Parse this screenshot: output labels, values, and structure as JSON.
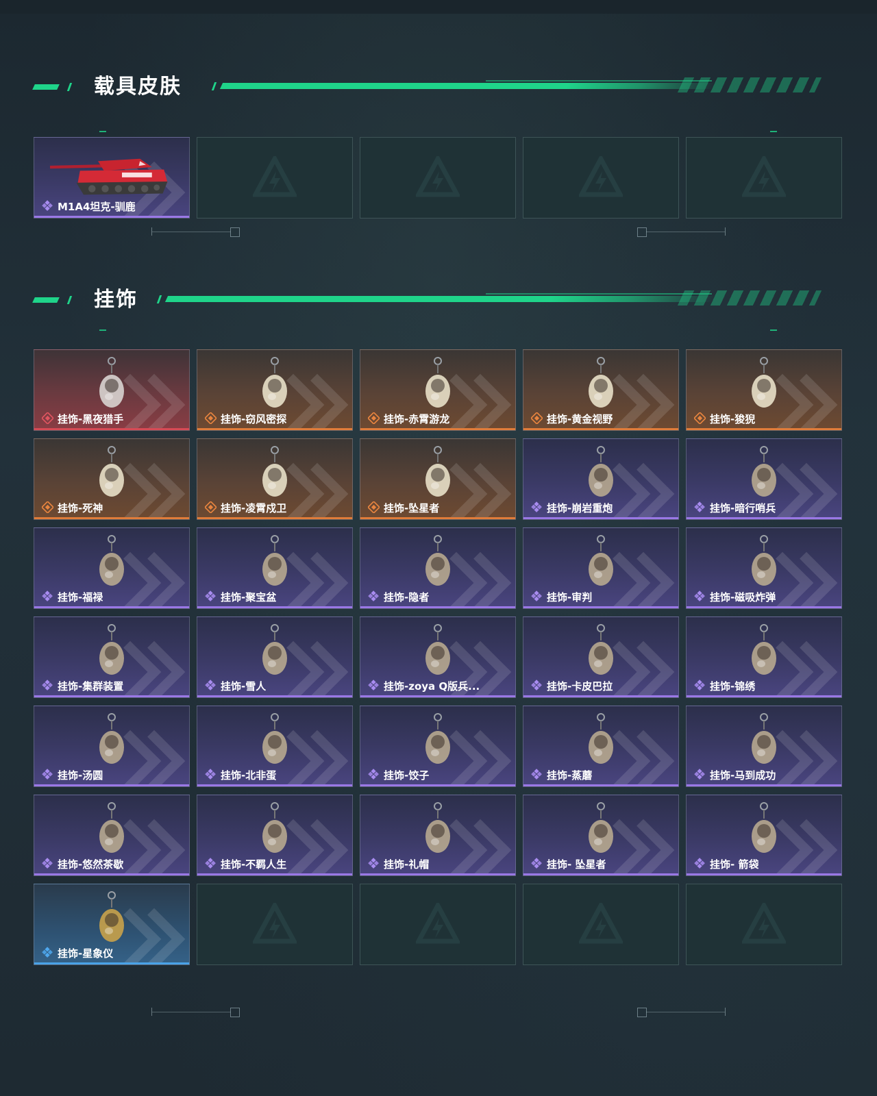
{
  "sections": {
    "vehicle": {
      "title": "载具皮肤"
    },
    "charms": {
      "title": "挂饰"
    }
  },
  "vehicle_items": [
    {
      "name": "M1A4坦克-驯鹿",
      "rarity": "purple",
      "icon": "tank-icon"
    },
    {
      "name": "",
      "rarity": "empty"
    },
    {
      "name": "",
      "rarity": "empty"
    },
    {
      "name": "",
      "rarity": "empty"
    },
    {
      "name": "",
      "rarity": "empty"
    }
  ],
  "charm_items": [
    {
      "name": "挂饰-黑夜猎手",
      "rarity": "red",
      "icon": "wolf-charm-icon"
    },
    {
      "name": "挂饰-窃风密探",
      "rarity": "orange",
      "icon": "rabbit-charm-icon"
    },
    {
      "name": "挂饰-赤霄游龙",
      "rarity": "orange",
      "icon": "dragon-charm-icon"
    },
    {
      "name": "挂饰-黄金视野",
      "rarity": "orange",
      "icon": "cat-charm-icon"
    },
    {
      "name": "挂饰-狻猊",
      "rarity": "orange",
      "icon": "lion-charm-icon"
    },
    {
      "name": "挂饰-死神",
      "rarity": "orange",
      "icon": "card-charm-icon"
    },
    {
      "name": "挂饰-凌霄戍卫",
      "rarity": "orange",
      "icon": "eagle-charm-icon"
    },
    {
      "name": "挂饰-坠星者",
      "rarity": "orange",
      "icon": "crystal-charm-icon"
    },
    {
      "name": "挂饰-崩岩重炮",
      "rarity": "purple",
      "icon": "soldier-charm-icon"
    },
    {
      "name": "挂饰-暗行哨兵",
      "rarity": "purple",
      "icon": "soldier-charm-icon"
    },
    {
      "name": "挂饰-福禄",
      "rarity": "purple",
      "icon": "gourd-charm-icon"
    },
    {
      "name": "挂饰-聚宝盆",
      "rarity": "purple",
      "icon": "bowl-charm-icon"
    },
    {
      "name": "挂饰-隐者",
      "rarity": "purple",
      "icon": "card-charm-icon"
    },
    {
      "name": "挂饰-审判",
      "rarity": "purple",
      "icon": "card-charm-icon"
    },
    {
      "name": "挂饰-磁吸炸弹",
      "rarity": "purple",
      "icon": "bomb-charm-icon"
    },
    {
      "name": "挂饰-集群装置",
      "rarity": "purple",
      "icon": "device-charm-icon"
    },
    {
      "name": "挂饰-雪人",
      "rarity": "purple",
      "icon": "snowman-charm-icon"
    },
    {
      "name": "挂饰-zoya  Q版兵...",
      "rarity": "purple",
      "icon": "device-charm-icon"
    },
    {
      "name": "挂饰-卡皮巴拉",
      "rarity": "purple",
      "icon": "capybara-charm-icon"
    },
    {
      "name": "挂饰-锦绣",
      "rarity": "purple",
      "icon": "butterfly-charm-icon"
    },
    {
      "name": "挂饰-汤圆",
      "rarity": "purple",
      "icon": "bowl-charm-icon"
    },
    {
      "name": "挂饰-北非蛋",
      "rarity": "purple",
      "icon": "pan-charm-icon"
    },
    {
      "name": "挂饰-饺子",
      "rarity": "purple",
      "icon": "plate-charm-icon"
    },
    {
      "name": "挂饰-蒸蘑",
      "rarity": "purple",
      "icon": "mushroom-charm-icon"
    },
    {
      "name": "挂饰-马到成功",
      "rarity": "purple",
      "icon": "horse-charm-icon"
    },
    {
      "name": "挂饰-悠然茶歇",
      "rarity": "purple",
      "icon": "cupcake-charm-icon"
    },
    {
      "name": "挂饰-不羁人生",
      "rarity": "purple",
      "icon": "sneaker-charm-icon"
    },
    {
      "name": "挂饰-礼帽",
      "rarity": "purple",
      "icon": "hat-charm-icon"
    },
    {
      "name": "挂饰- 坠星者",
      "rarity": "purple",
      "icon": "pyramid-charm-icon"
    },
    {
      "name": "挂饰- 箭袋",
      "rarity": "purple",
      "icon": "quiver-charm-icon"
    },
    {
      "name": "挂饰-星象仪",
      "rarity": "blue",
      "icon": "astrolabe-charm-icon"
    },
    {
      "name": "",
      "rarity": "empty"
    },
    {
      "name": "",
      "rarity": "empty"
    },
    {
      "name": "",
      "rarity": "empty"
    },
    {
      "name": "",
      "rarity": "empty"
    }
  ],
  "colors": {
    "accent": "#1fd48a",
    "purple": "#9a78e6",
    "orange": "#e07c3a",
    "red": "#d64a55",
    "blue": "#4aa3e8"
  }
}
